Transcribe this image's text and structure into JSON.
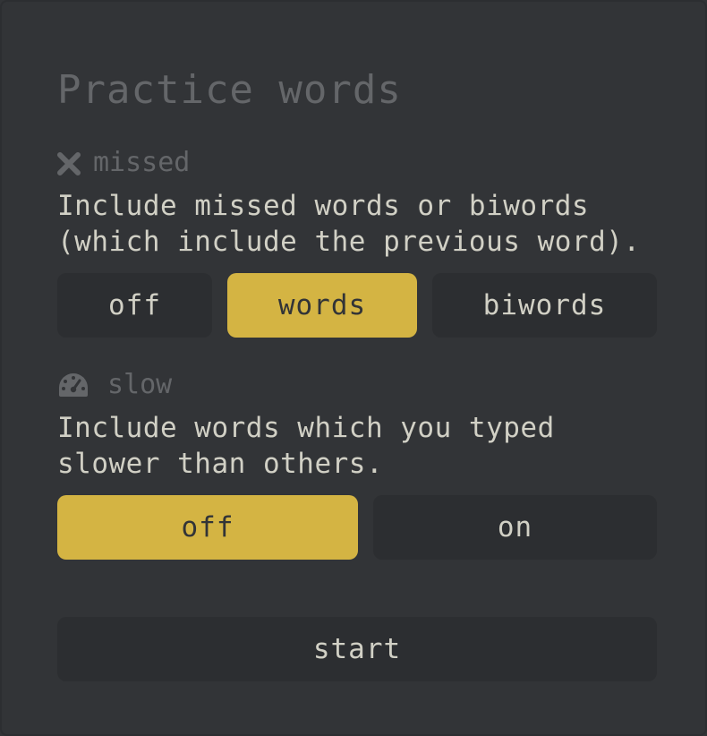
{
  "title": "Practice words",
  "missed": {
    "label": "missed",
    "icon": "close-icon",
    "description_line1": "Include missed words or biwords",
    "description_line2": "(which include the previous word).",
    "options": [
      "off",
      "words",
      "biwords"
    ],
    "selected": "words"
  },
  "slow": {
    "label": "slow",
    "icon": "speedometer-icon",
    "description_line1": "Include words which you typed",
    "description_line2": "slower than others.",
    "options": [
      "off",
      "on"
    ],
    "selected": "off"
  },
  "start_label": "start",
  "colors": {
    "background": "#323437",
    "button_bg": "#2c2e31",
    "accent": "#d4b443",
    "text": "#d1d0c5",
    "muted": "#646669"
  }
}
